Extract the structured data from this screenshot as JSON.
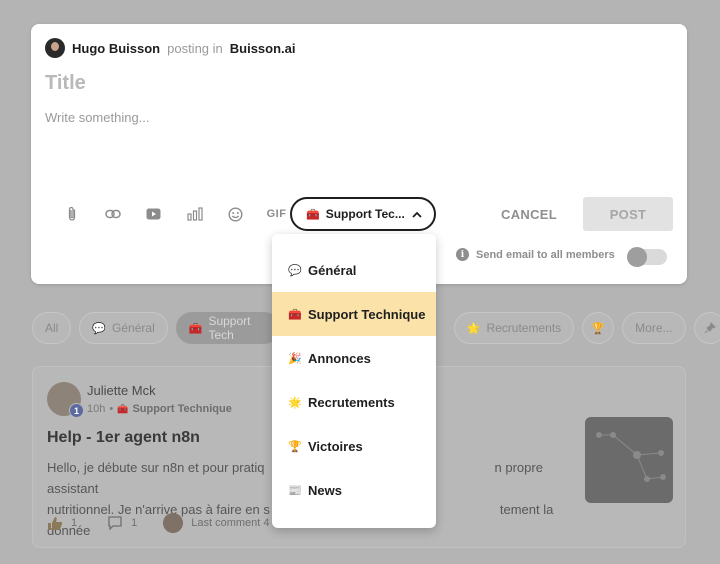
{
  "composer": {
    "author_name": "Hugo Buisson",
    "posting_in_text": "posting in",
    "community_name": "Buisson.ai",
    "title_placeholder": "Title",
    "body_placeholder": "Write something...",
    "toolbar": {
      "attach_icon": "paperclip-icon",
      "link_icon": "link-icon",
      "video_icon": "youtube-icon",
      "poll_icon": "poll-icon",
      "emoji_icon": "emoji-icon",
      "gif_label": "GIF"
    },
    "category_select": {
      "emoji": "🧰",
      "label": "Support Tec..."
    },
    "cancel_label": "CANCEL",
    "post_label": "POST",
    "send_email_label": "Send email to all members",
    "send_email_enabled": false
  },
  "category_menu": {
    "items": [
      {
        "emoji": "💬",
        "label": "Général",
        "selected": false
      },
      {
        "emoji": "🧰",
        "label": "Support Technique",
        "selected": true
      },
      {
        "emoji": "🎉",
        "label": "Annonces",
        "selected": false
      },
      {
        "emoji": "🌟",
        "label": "Recrutements",
        "selected": false
      },
      {
        "emoji": "🏆",
        "label": "Victoires",
        "selected": false
      },
      {
        "emoji": "📰",
        "label": "News",
        "selected": false
      }
    ]
  },
  "filters": {
    "all": "All",
    "general": {
      "emoji": "💬",
      "label": "Général"
    },
    "support": {
      "emoji": "🧰",
      "label": "Support Tech"
    },
    "recrutements": {
      "emoji": "🌟",
      "label": "Recrutements"
    },
    "more_emoji": "🏆",
    "more": "More..."
  },
  "post": {
    "author": "Juliette Mck",
    "level": "1",
    "time": "10h",
    "separator": "•",
    "category_emoji": "🧰",
    "category": "Support Technique",
    "title": "Help - 1er agent n8n",
    "body_line1_start": "Hello, je débute sur n8n et pour pratiq",
    "body_line1_end": "n propre assistant",
    "body_line2_start": "nutritionnel. Je n'arrive pas à faire en s",
    "body_line2_end": "tement la donnée",
    "likes": "1",
    "comments": "1",
    "last_comment": "Last comment 4"
  },
  "colors": {
    "overlay": "#b4b4b4",
    "selected_item_bg": "#fae2a9",
    "post_button_bg": "#e2e2e2"
  }
}
